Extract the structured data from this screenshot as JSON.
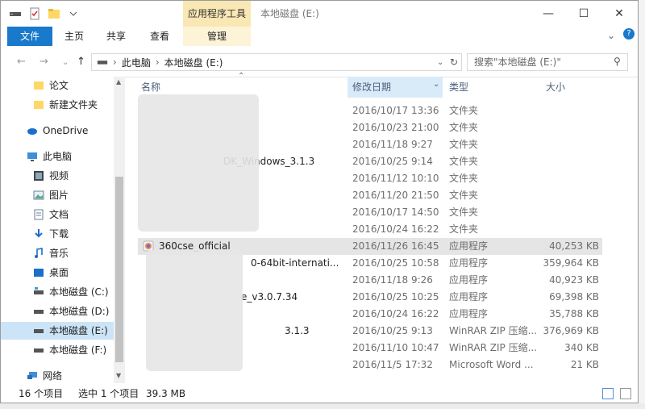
{
  "title": {
    "window_title": "本地磁盘 (E:)",
    "context_tab": "应用程序工具"
  },
  "ribbon": {
    "tabs": [
      "文件",
      "主页",
      "共享",
      "查看",
      "管理"
    ]
  },
  "address": {
    "path": [
      "此电脑",
      "本地磁盘 (E:)"
    ],
    "search_placeholder": "搜索\"本地磁盘 (E:)\""
  },
  "sidebar": {
    "items": [
      {
        "label": "论文",
        "icon": "folder-icon"
      },
      {
        "label": "新建文件夹",
        "icon": "folder-icon"
      },
      {
        "label": "OneDrive",
        "icon": "cloud-icon"
      },
      {
        "label": "此电脑",
        "icon": "computer-icon"
      },
      {
        "label": "视频",
        "icon": "video-icon"
      },
      {
        "label": "图片",
        "icon": "picture-icon"
      },
      {
        "label": "文档",
        "icon": "document-icon"
      },
      {
        "label": "下载",
        "icon": "download-icon"
      },
      {
        "label": "音乐",
        "icon": "music-icon"
      },
      {
        "label": "桌面",
        "icon": "desktop-icon"
      },
      {
        "label": "本地磁盘 (C:)",
        "icon": "drive-icon"
      },
      {
        "label": "本地磁盘 (D:)",
        "icon": "drive-icon"
      },
      {
        "label": "本地磁盘 (E:)",
        "icon": "drive-icon"
      },
      {
        "label": "本地磁盘 (F:)",
        "icon": "drive-icon"
      },
      {
        "label": "网络",
        "icon": "network-icon"
      }
    ]
  },
  "columns": {
    "name": "名称",
    "date": "修改日期",
    "type": "类型",
    "size": "大小"
  },
  "files": [
    {
      "name": "",
      "date": "2016/10/17 13:36",
      "type": "文件夹",
      "size": ""
    },
    {
      "name": "",
      "date": "2016/10/23 21:00",
      "type": "文件夹",
      "size": ""
    },
    {
      "name": "",
      "date": "2016/11/18 9:27",
      "type": "文件夹",
      "size": ""
    },
    {
      "name": "DK_Windows_3.1.3",
      "date": "2016/10/25 9:14",
      "type": "文件夹",
      "size": ""
    },
    {
      "name": "",
      "date": "2016/11/12 10:10",
      "type": "文件夹",
      "size": ""
    },
    {
      "name": "",
      "date": "2016/11/20 21:50",
      "type": "文件夹",
      "size": ""
    },
    {
      "name": "",
      "date": "2016/10/17 14:50",
      "type": "文件夹",
      "size": ""
    },
    {
      "name": "",
      "date": "2016/10/24 16:22",
      "type": "文件夹",
      "size": ""
    },
    {
      "name": "360cse_official",
      "date": "2016/11/26 16:45",
      "type": "应用程序",
      "size": "40,253 KB"
    },
    {
      "name": "0-64bit-internati...",
      "date": "2016/10/25 10:58",
      "type": "应用程序",
      "size": "359,964 KB"
    },
    {
      "name": "",
      "date": "2016/11/18 9:26",
      "type": "应用程序",
      "size": "40,923 KB"
    },
    {
      "name": "e_v3.0.7.34",
      "date": "2016/10/25 10:25",
      "type": "应用程序",
      "size": "69,398 KB"
    },
    {
      "name": "",
      "date": "2016/10/24 16:22",
      "type": "应用程序",
      "size": "35,788 KB"
    },
    {
      "name": "3.1.3",
      "date": "2016/10/25 9:13",
      "type": "WinRAR ZIP 压缩...",
      "size": "376,969 KB"
    },
    {
      "name": "",
      "date": "2016/11/10 10:47",
      "type": "WinRAR ZIP 压缩...",
      "size": "340 KB"
    },
    {
      "name": "",
      "date": "2016/11/5 17:32",
      "type": "Microsoft Word ...",
      "size": "21 KB"
    }
  ],
  "status": {
    "count": "16 个项目",
    "selected": "选中 1 个项目",
    "size": "39.3 MB"
  }
}
